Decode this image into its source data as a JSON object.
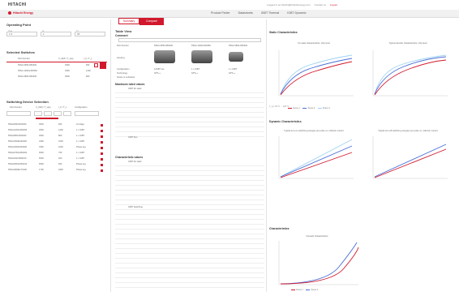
{
  "header": {
    "logo": "HITACHI",
    "links": [
      "Logged in as hitachi@hitachienergy.com",
      "Contact us",
      "Logout"
    ],
    "brand": "Hitachi Energy",
    "nav": [
      "Product Finder",
      "Datasheets",
      "IGBT Thermal",
      "IGBT Dynamic"
    ]
  },
  "left": {
    "operating_title": "Operating Point",
    "fields": [
      {
        "label": "Vce",
        "value": "1.9"
      },
      {
        "label": "Ic",
        "value": "1"
      },
      {
        "label": "Tj",
        "value": "25"
      }
    ],
    "selected_title": "Selected Switches",
    "selected_headers": [
      "Part Number",
      "V_CES / T_vjop",
      "I_C / T_c"
    ],
    "selected_rows": [
      {
        "part": "5SNA 0650J450300",
        "v": "4500",
        "i": "650"
      },
      {
        "part": "5SNA 1200G450350",
        "v": "4500",
        "i": "1200"
      },
      {
        "part": "5SNA 0800J450300",
        "v": "4500",
        "i": "800"
      }
    ],
    "switching_title": "Switching Device Selection",
    "switching_headers": [
      "Part Number",
      "V_CES / T_vjop",
      "I_C / T_c",
      "Configuration"
    ],
    "switching_rows": [
      {
        "part": "5SNA0650J450300",
        "v": "4500",
        "i": "650",
        "c": "H bridge"
      },
      {
        "part": "5SNA1200G450350",
        "v": "4500",
        "i": "1200",
        "c": "1 x IGBT"
      },
      {
        "part": "5SNA0800J450300",
        "v": "4500",
        "i": "800",
        "c": "1 x IGBT"
      },
      {
        "part": "5SNA1500E330305",
        "v": "3300",
        "i": "1500",
        "c": "1 x IGBT"
      },
      {
        "part": "5SNA1000N330300",
        "v": "3300",
        "i": "1000",
        "c": "Phase leg"
      },
      {
        "part": "5SNA0750G650300",
        "v": "6500",
        "i": "750",
        "c": "1 x IGBT"
      },
      {
        "part": "5SNA0400J650100",
        "v": "6500",
        "i": "400",
        "c": "1 x IGBT"
      },
      {
        "part": "5SNA0600G650100",
        "v": "6500",
        "i": "600",
        "c": "Phase leg"
      },
      {
        "part": "5SNA1800E170100",
        "v": "1700",
        "i": "1800",
        "c": "Phase leg"
      }
    ]
  },
  "middle": {
    "tabs": [
      "Summary",
      "Compare"
    ],
    "section_title": "Table View",
    "comment": "Comment",
    "rows": [
      "Part Number",
      "Housing",
      "Configuration",
      "Technology",
      "Series or substitute"
    ],
    "parts": [
      "5SNA 0650J450300",
      "5SNA 1200G450350",
      "5SNA 0800J450300"
    ],
    "configs": [
      "1/IGBT set",
      "1 x IGBT",
      "1 x IGBT"
    ],
    "tech": [
      "SPT++",
      "SPT++",
      "SPT++"
    ],
    "max_title": "Maximum rated values",
    "char_title": "Characteristic values",
    "subsections": [
      "IGBT Dc static",
      "IGBT Dyn",
      "IGBT Dc static",
      "IGBT Switching"
    ]
  },
  "right": {
    "static_title": "Static Characteristics",
    "chart1_title": "On-state characteristics, chip level",
    "chart2_title": "Typical transfer characteristics, chip level",
    "dynamic_title": "Dynamic Characteristics",
    "chart3_title": "Typical turn-on switching energies per pulse vs. collector current",
    "chart4_title": "Typical turn-off switching energies per pulse vs. collector current",
    "chart5_section": "Characteristics",
    "chart5_title": "Forward characteristics",
    "legend": [
      "Series 1",
      "Series 2",
      "Series 3"
    ],
    "colors": {
      "red": "#d1182c",
      "blue": "#4a6fd8",
      "light": "#9fd3f0"
    }
  }
}
